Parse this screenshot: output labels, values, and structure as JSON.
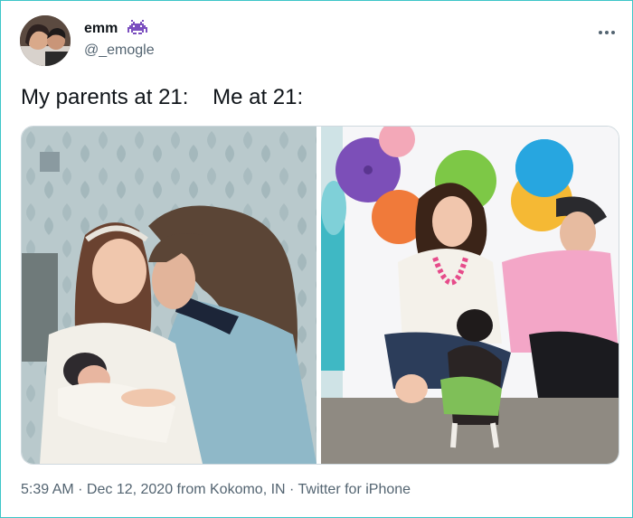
{
  "tweet": {
    "display_name": "emm",
    "handle": "@_emogle",
    "text": "My parents at 21:    Me at 21:",
    "timestamp": "5:39 AM · Dec 12, 2020",
    "location": " from Kokomo, IN",
    "separator": " · ",
    "source": "Twitter for iPhone"
  },
  "icons": {
    "more": "more-icon",
    "badge": "space-invader-icon"
  },
  "colors": {
    "card_border": "#3cc6c8",
    "secondary_text": "#536471",
    "badge": "#7b4fbf"
  }
}
